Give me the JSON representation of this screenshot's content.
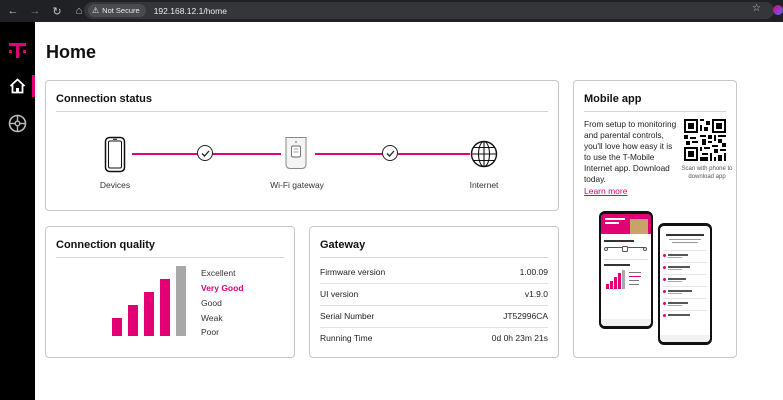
{
  "browser": {
    "security": "Not Secure",
    "url": "192.168.12.1/home"
  },
  "sidebar": {
    "items": [
      {
        "name": "home",
        "active": true
      },
      {
        "name": "network",
        "active": false
      }
    ]
  },
  "page": {
    "title": "Home"
  },
  "connection_status": {
    "title": "Connection status",
    "nodes": [
      {
        "label": "Devices",
        "icon": "phone-icon"
      },
      {
        "label": "Wi-Fi gateway",
        "icon": "gateway-icon"
      },
      {
        "label": "Internet",
        "icon": "globe-icon"
      }
    ]
  },
  "mobile_app": {
    "title": "Mobile app",
    "description": "From setup to monitoring and parental controls, you'll love how easy it is to use the T-Mobile Internet app. Download today.",
    "scan_text": "Scan with phone to download app",
    "learn_more": "Learn more"
  },
  "connection_quality": {
    "title": "Connection quality",
    "levels": [
      "Excellent",
      "Very Good",
      "Good",
      "Weak",
      "Poor"
    ],
    "current": "Very Good",
    "signal_bars_active": 4,
    "signal_bars_total": 5
  },
  "gateway": {
    "title": "Gateway",
    "rows": [
      {
        "key": "Firmware version",
        "value": "1.00.09"
      },
      {
        "key": "UI version",
        "value": "v1.9.0"
      },
      {
        "key": "Serial Number",
        "value": "JT52996CA"
      },
      {
        "key": "Running Time",
        "value": "0d 0h 23m 21s"
      }
    ]
  },
  "colors": {
    "brand": "#e20074",
    "inactive_bar": "#a8a8a8",
    "sidebar": "#000000"
  }
}
